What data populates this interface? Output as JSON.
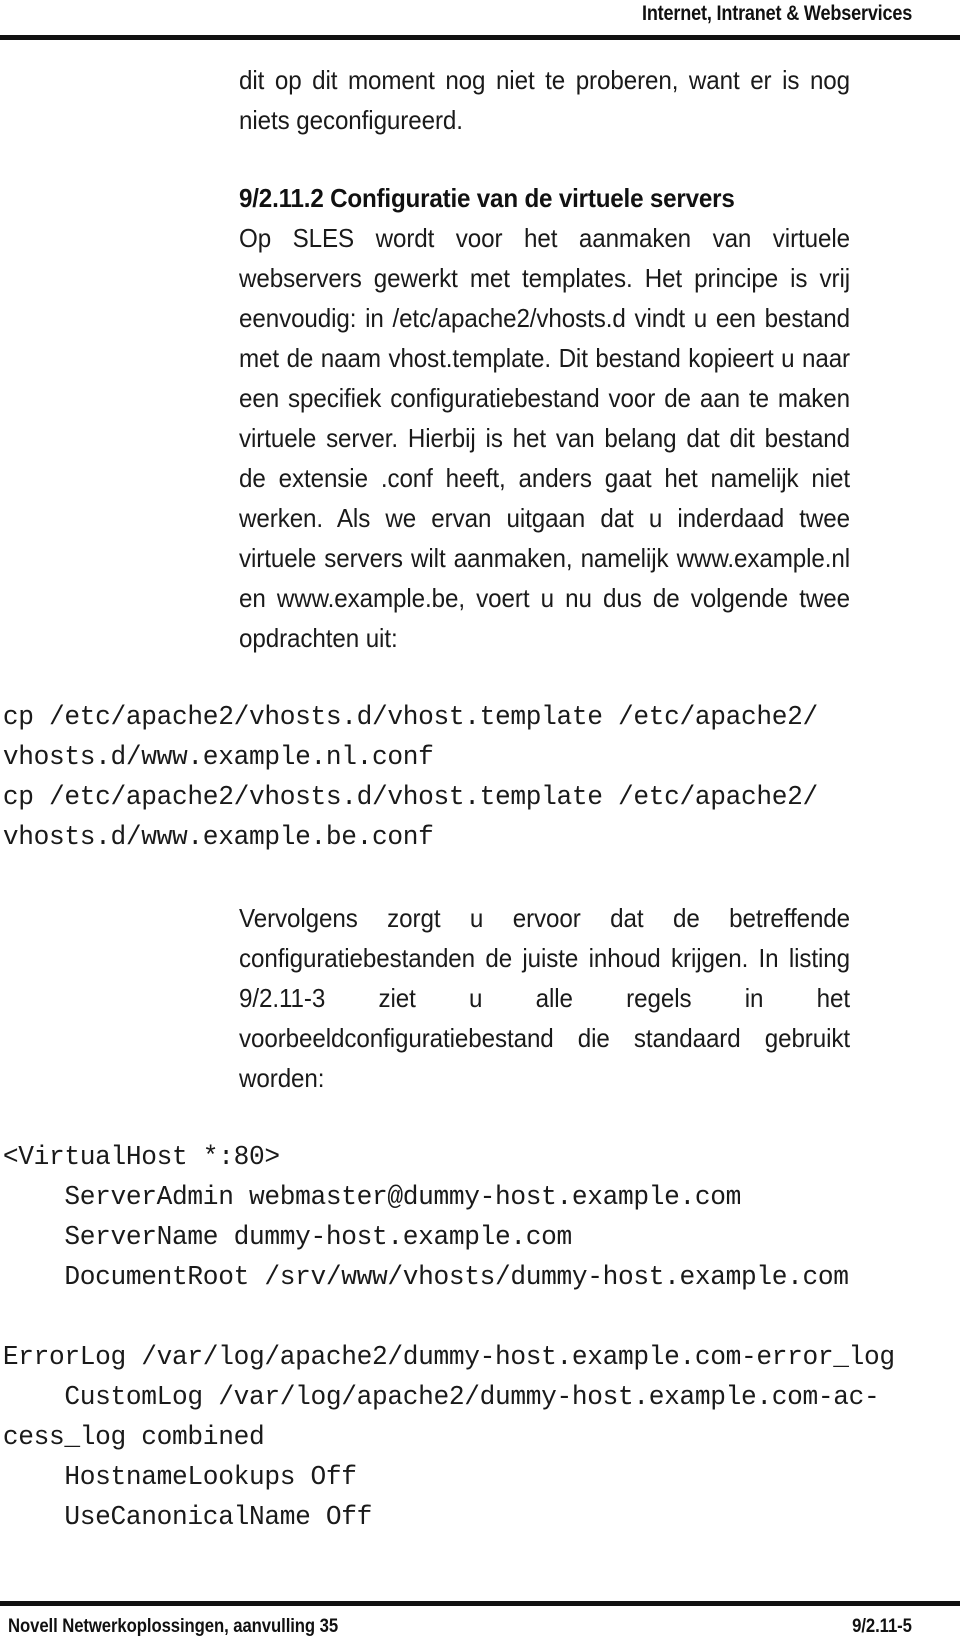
{
  "header": {
    "title": "Internet, Intranet & Webservices"
  },
  "footer": {
    "left": "Novell Netwerkoplossingen, aanvulling 35",
    "right": "9/2.11-5"
  },
  "content": {
    "intro_paragraph": "dit op dit moment nog niet te proberen, want er is nog niets geconfigureerd.",
    "section_heading": "9/2.11.2 Configuratie van de virtuele servers",
    "body_paragraph_1": "Op SLES wordt voor het aanmaken van virtuele webservers gewerkt met templates. Het principe is vrij eenvoudig: in /etc/apache2/vhosts.d vindt u een bestand met de naam vhost.template. Dit bestand kopieert u naar een specifiek configuratiebestand voor de aan te maken virtuele server. Hierbij is het van belang dat dit bestand de extensie .conf heeft, anders gaat het namelijk niet werken. Als we ervan uitgaan dat u inderdaad twee virtuele servers wilt aanmaken, namelijk www.example.nl en www.example.be, voert u nu dus de volgende twee opdrachten uit:",
    "command_block": [
      "cp /etc/apache2/vhosts.d/vhost.template /etc/apache2/",
      "vhosts.d/www.example.nl.conf",
      "cp /etc/apache2/vhosts.d/vhost.template /etc/apache2/",
      "vhosts.d/www.example.be.conf"
    ],
    "body_paragraph_2": "Vervolgens zorgt u ervoor dat de betreffende configuratiebestanden de juiste inhoud krijgen. In listing 9/2.11-3 ziet u alle regels in het voorbeeldconfiguratiebestand die standaard gebruikt worden:",
    "listing_block_1": [
      "<VirtualHost *:80>",
      "    ServerAdmin webmaster@dummy-host.example.com",
      "    ServerName dummy-host.example.com",
      "    DocumentRoot /srv/www/vhosts/dummy-host.example.com"
    ],
    "listing_block_2": [
      "ErrorLog /var/log/apache2/dummy-host.example.com-error_log",
      "    CustomLog /var/log/apache2/dummy-host.example.com-ac-",
      "cess_log combined",
      "    HostnameLookups Off",
      "    UseCanonicalName Off"
    ]
  }
}
